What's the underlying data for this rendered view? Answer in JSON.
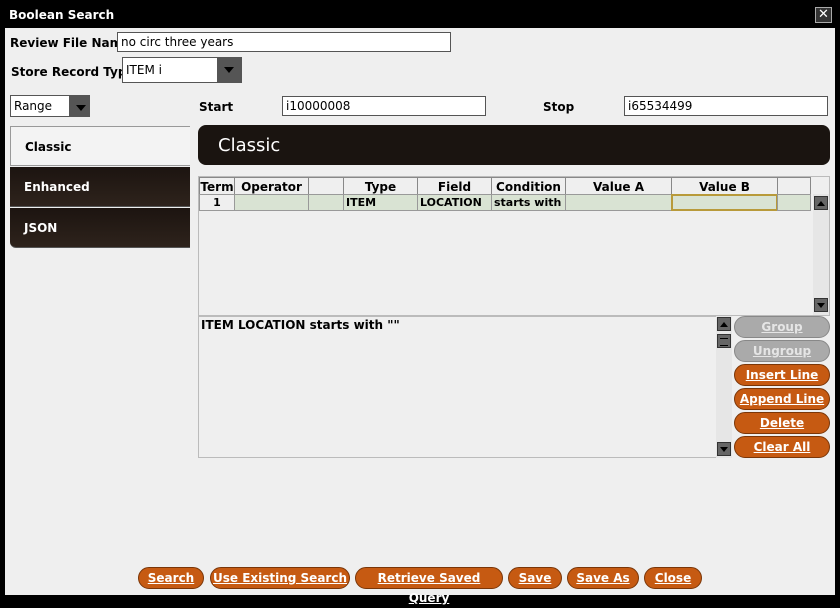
{
  "window": {
    "title": "Boolean Search",
    "close_glyph": "✕"
  },
  "form": {
    "review_file_label": "Review File Name:",
    "review_file_value": "no circ three years",
    "store_record_label": "Store Record Type:",
    "store_record_value": "ITEM  i",
    "range_select": "Range",
    "start_label": "Start",
    "start_value": "i10000008",
    "stop_label": "Stop",
    "stop_value": "i65534499"
  },
  "tabs": [
    {
      "label": "Classic",
      "active": true
    },
    {
      "label": "Enhanced",
      "active": false
    },
    {
      "label": "JSON",
      "active": false
    }
  ],
  "panel_title": "Classic",
  "grid": {
    "columns": [
      "Term",
      "Operator",
      "",
      "Type",
      "Field",
      "Condition",
      "Value A",
      "Value B",
      ""
    ],
    "rows": [
      {
        "term": "1",
        "operator": "",
        "blank": "",
        "type": "ITEM",
        "field": "LOCATION",
        "condition": "starts with",
        "value_a": "",
        "value_b": ""
      }
    ]
  },
  "query_text": "ITEM  LOCATION  starts with  \"\"",
  "side_buttons": {
    "group": "Group",
    "ungroup": "Ungroup",
    "insert_line": "Insert Line",
    "append_line": "Append Line",
    "delete": "Delete",
    "clear_all": "Clear All"
  },
  "bottom_buttons": {
    "search": "Search",
    "use_existing": "Use Existing Search",
    "retrieve_saved": "Retrieve Saved Query",
    "save": "Save",
    "save_as": "Save As",
    "close": "Close"
  },
  "colors": {
    "accent_button": "#c65a12",
    "selected_row": "#d9e3d3",
    "dark_tab": "#1c1410",
    "active_cell_border": "#b89a3a"
  }
}
